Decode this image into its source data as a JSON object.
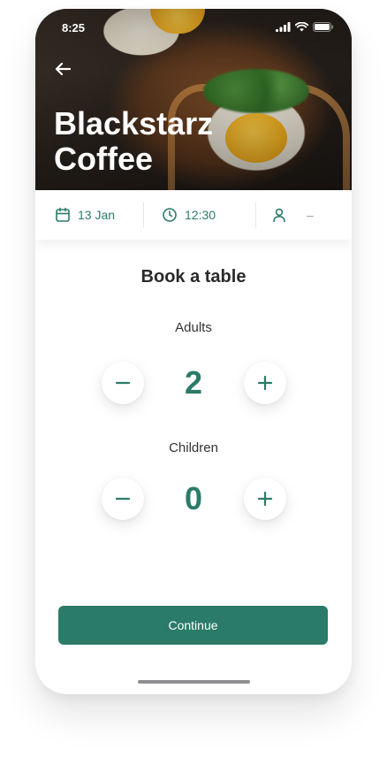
{
  "status_bar": {
    "time": "8:25"
  },
  "header": {
    "title_line1": "Blackstarz",
    "title_line2": "Coffee"
  },
  "info_bar": {
    "date": "13 Jan",
    "time": "12:30",
    "guests": "–"
  },
  "booking": {
    "title": "Book a table",
    "adults": {
      "label": "Adults",
      "value": "2"
    },
    "children": {
      "label": "Children",
      "value": "0"
    }
  },
  "actions": {
    "continue_label": "Continue"
  },
  "colors": {
    "accent": "#2b7b69",
    "title_text": "#2a2a2a"
  },
  "icons": [
    "back-arrow-icon",
    "calendar-icon",
    "clock-icon",
    "person-icon",
    "minus-icon",
    "plus-icon",
    "signal-icon",
    "wifi-icon",
    "battery-icon"
  ]
}
